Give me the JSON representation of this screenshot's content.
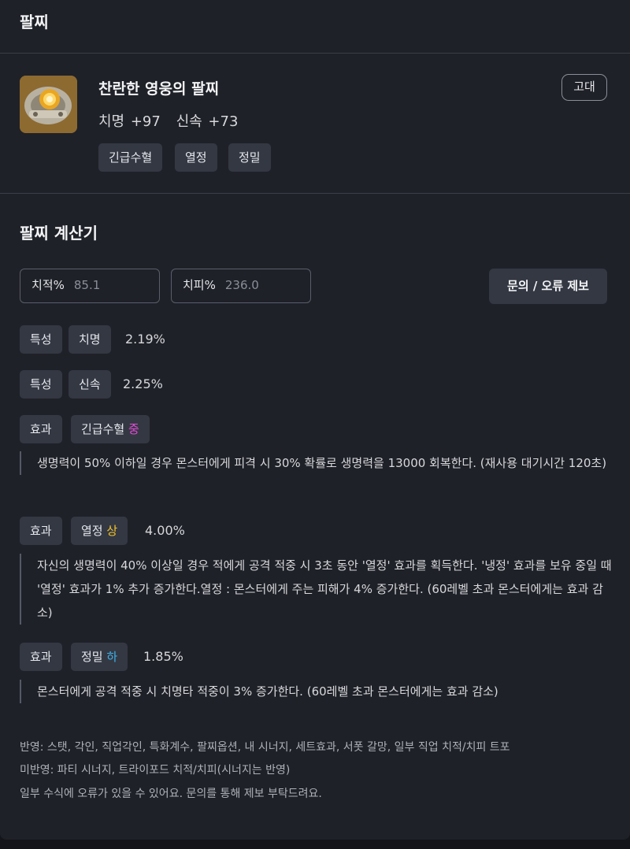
{
  "header": {
    "title": "팔찌"
  },
  "item": {
    "name": "찬란한 영웅의 팔찌",
    "grade": "고대",
    "stats": [
      "치명 +97",
      "신속 +73"
    ],
    "effects": [
      "긴급수혈",
      "열정",
      "정밀"
    ]
  },
  "calculator": {
    "title": "팔찌 계산기",
    "crit_rate": {
      "label": "치적%",
      "placeholder": "85.1"
    },
    "crit_damage": {
      "label": "치피%",
      "placeholder": "236.0"
    },
    "report_button": "문의 / 오류 제보",
    "rows": [
      {
        "type": "특성",
        "name": "치명",
        "grade": "",
        "value": "2.19%"
      },
      {
        "type": "특성",
        "name": "신속",
        "grade": "",
        "value": "2.25%"
      },
      {
        "type": "효과",
        "name": "긴급수혈",
        "grade": "중",
        "value": "",
        "description": "생명력이 50% 이하일 경우 몬스터에게 피격 시 30% 확률로 생명력을 13000 회복한다. (재사용 대기시간 120초)"
      },
      {
        "type": "효과",
        "name": "열정",
        "grade": "상",
        "value": "4.00%",
        "description": "자신의 생명력이 40% 이상일 경우 적에게 공격 적중 시 3초 동안 '열정' 효과를 획득한다. '냉정' 효과를 보유 중일 때 '열정' 효과가 1% 추가 증가한다.열정 : 몬스터에게 주는 피해가 4% 증가한다. (60레벨 초과 몬스터에게는 효과 감소)"
      },
      {
        "type": "효과",
        "name": "정밀",
        "grade": "하",
        "value": "1.85%",
        "description": "몬스터에게 공격 적중 시 치명타 적중이 3% 증가한다. (60레벨 초과 몬스터에게는 효과 감소)"
      }
    ]
  },
  "footer": {
    "applied": "반영: 스탯, 각인, 직업각인, 특화계수, 팔찌옵션, 내 시너지, 세트효과, 서폿 갈망, 일부 직업 치적/치피 트포",
    "not_applied": "미반영: 파티 시너지, 트라이포드 치적/치피(시너지는 반영)",
    "notice": "일부 수식에 오류가 있을 수 있어요. 문의를 통해 제보 부탁드려요."
  },
  "colors": {
    "grade_mid": "#e24ad6",
    "grade_high": "#f2c32a",
    "grade_low": "#3fb0e8"
  }
}
